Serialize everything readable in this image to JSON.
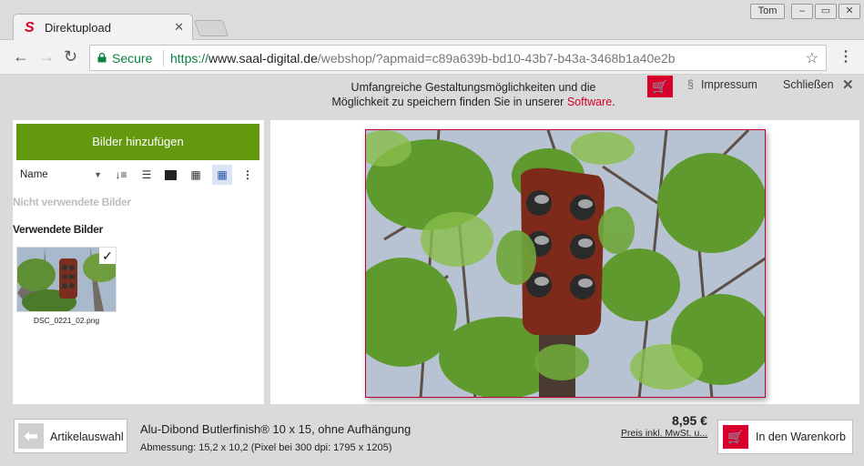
{
  "browser": {
    "tab_title": "Direktupload",
    "tab_logo": "S",
    "profile_name": "Tom",
    "secure_label": "Secure",
    "url_scheme": "https://",
    "url_host": "www.saal-digital.de",
    "url_path": "/webshop/?apmaid=c89a639b-bd10-43b7-b43a-3468b1a40e2b",
    "window_buttons": [
      "minimize",
      "maximize",
      "close"
    ]
  },
  "infobar": {
    "line1": "Umfangreiche Gestaltungsmöglichkeiten und die",
    "line2_prefix": "Möglichkeit zu speichern finden Sie in unserer",
    "line2_link": "Software",
    "line2_suffix": ".",
    "impressum_symbol": "§",
    "impressum": "Impressum",
    "close": "Schließen"
  },
  "left_panel": {
    "add_button": "Bilder hinzufügen",
    "sort_value": "Name",
    "unused_heading": "Nicht verwendete Bilder",
    "used_heading": "Verwendete Bilder",
    "thumbnail": {
      "filename": "DSC_0221_02.png",
      "check": "✓"
    }
  },
  "footer": {
    "back_button": "Artikelauswahl",
    "product_name": "Alu-Dibond Butlerfinish® 10 x 15, ohne Aufhängung",
    "product_dims": "Abmessung: 15,2 x 10,2 (Pixel bei 300 dpi: 1795 x 1205)",
    "price": "8,95 €",
    "price_note": "Preis inkl. MwSt. u...",
    "cart_button": "In den Warenkorb"
  },
  "colors": {
    "accent_red": "#d6002a",
    "green_button": "#62990f",
    "secure_green": "#0b8043"
  }
}
